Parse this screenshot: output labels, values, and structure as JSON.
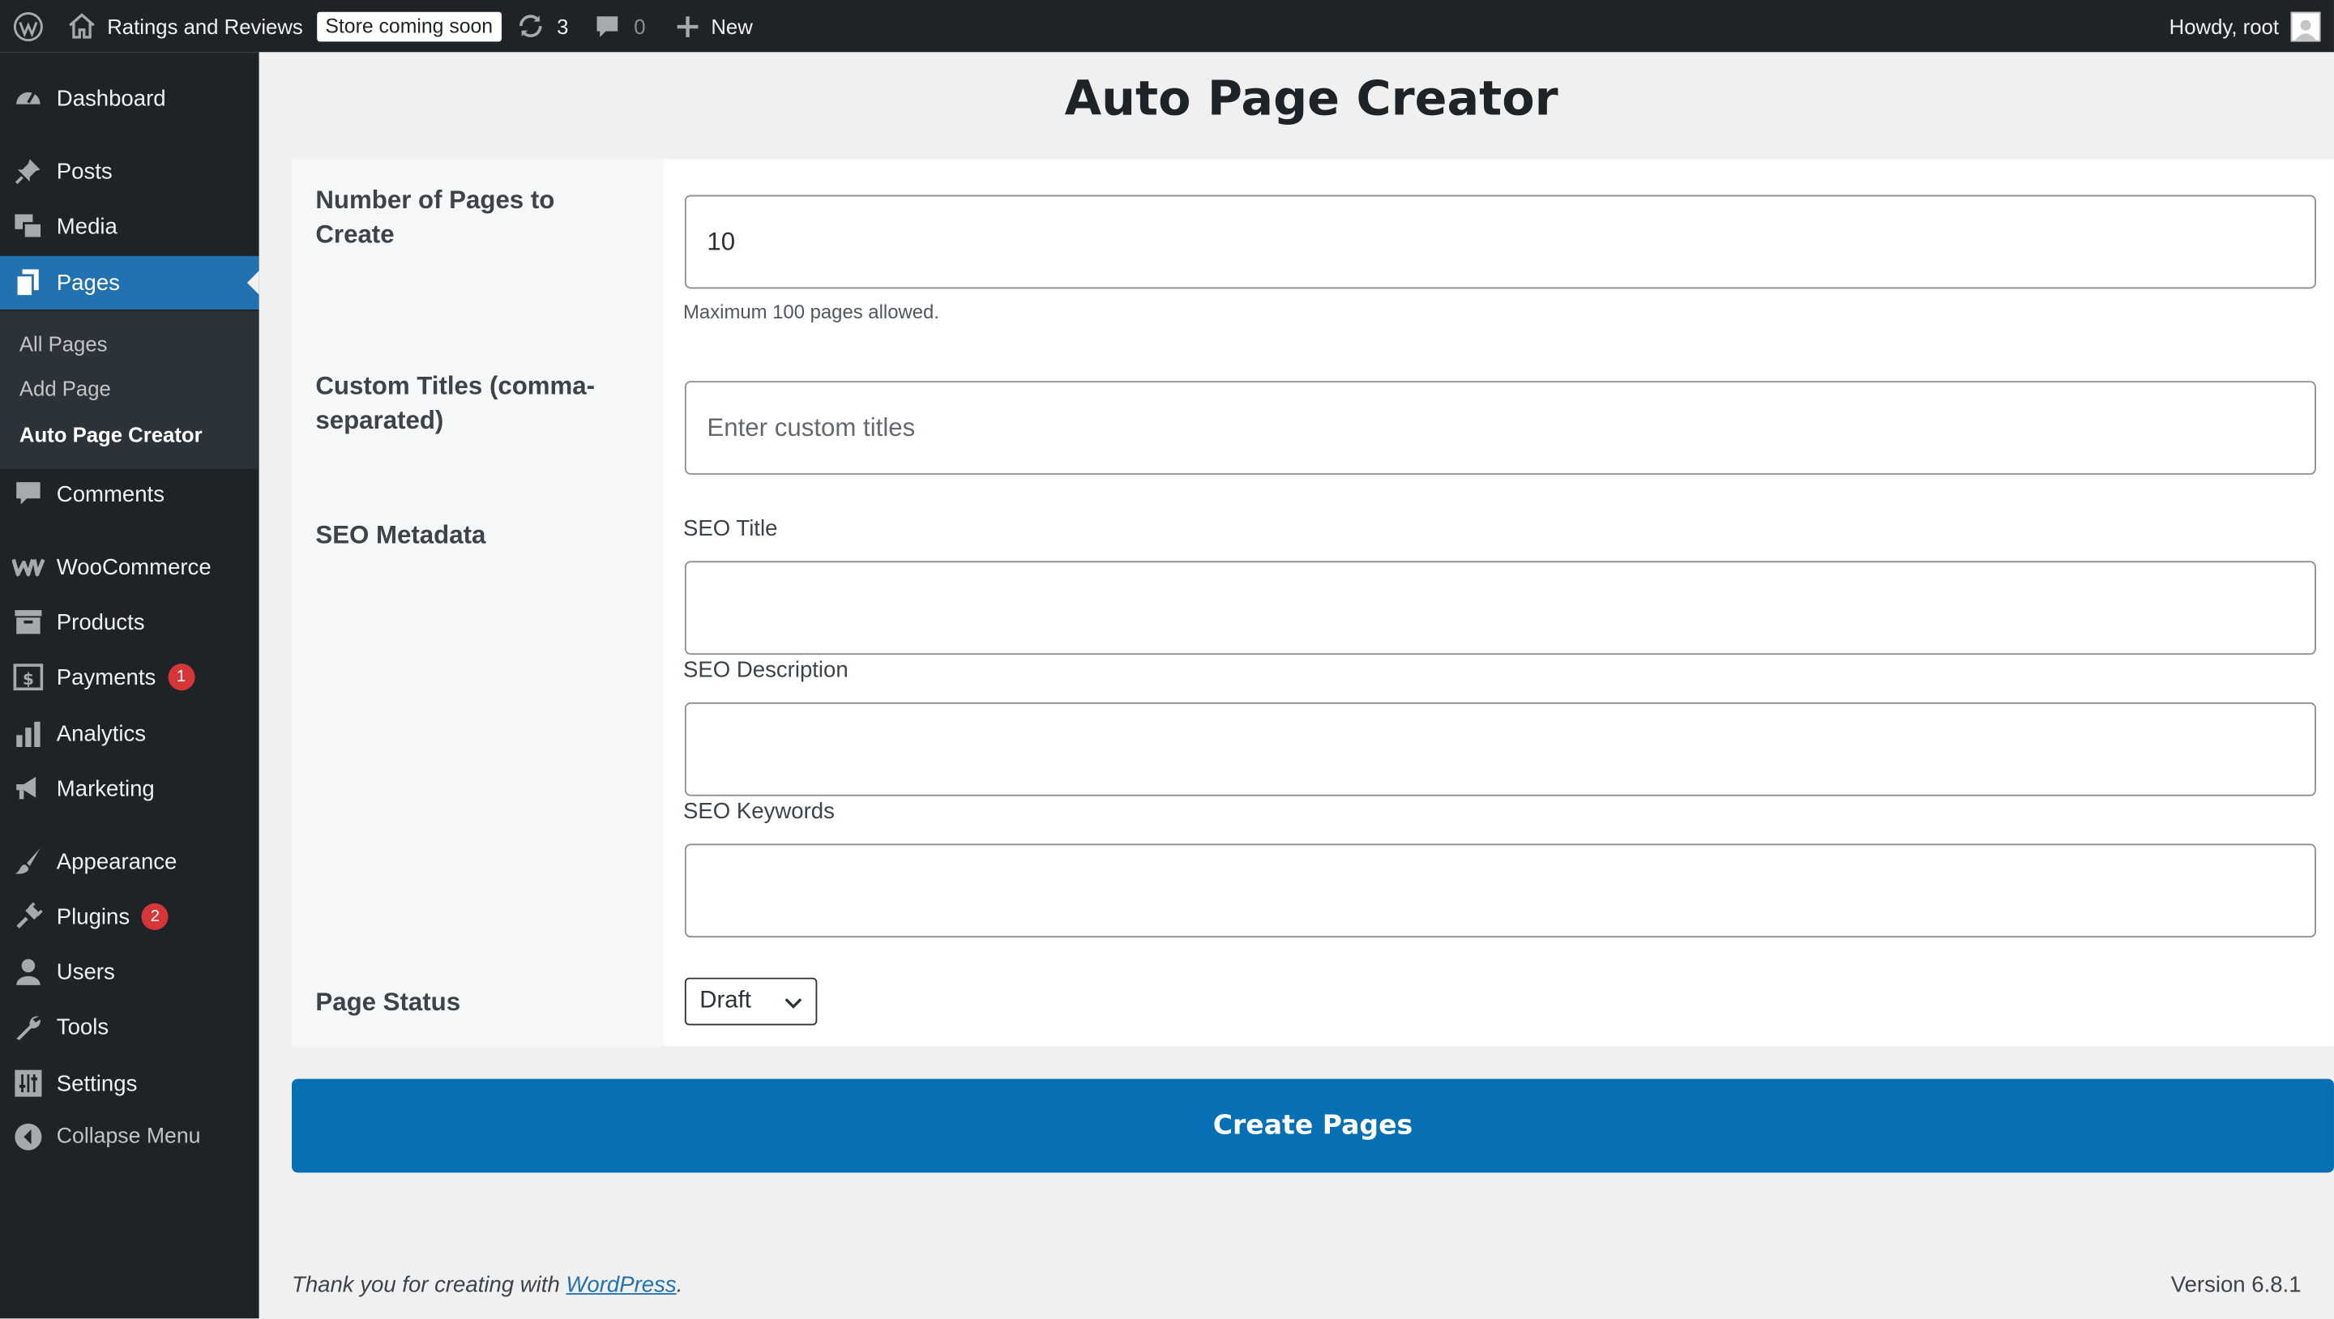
{
  "admin_bar": {
    "site_name": "Ratings and Reviews",
    "store_badge": "Store coming soon",
    "updates_count": "3",
    "comments_count": "0",
    "new_label": "New",
    "greeting": "Howdy, root"
  },
  "sidebar": {
    "dashboard": "Dashboard",
    "posts": "Posts",
    "media": "Media",
    "pages": "Pages",
    "sub_all_pages": "All Pages",
    "sub_add_page": "Add Page",
    "sub_auto_page_creator": "Auto Page Creator",
    "comments": "Comments",
    "woocommerce": "WooCommerce",
    "products": "Products",
    "payments": "Payments",
    "payments_badge": "1",
    "analytics": "Analytics",
    "marketing": "Marketing",
    "appearance": "Appearance",
    "plugins": "Plugins",
    "plugins_badge": "2",
    "users": "Users",
    "tools": "Tools",
    "settings": "Settings",
    "collapse": "Collapse Menu"
  },
  "main": {
    "title": "Auto Page Creator",
    "num_pages_label": "Number of Pages to Create",
    "num_pages_value": "10",
    "num_pages_hint": "Maximum 100 pages allowed.",
    "custom_titles_label": "Custom Titles (comma-separated)",
    "custom_titles_placeholder": "Enter custom titles",
    "seo_label": "SEO Metadata",
    "seo_title_label": "SEO Title",
    "seo_title_value": "",
    "seo_description_label": "SEO Description",
    "seo_description_value": "",
    "seo_keywords_label": "SEO Keywords",
    "seo_keywords_value": "",
    "page_status_label": "Page Status",
    "page_status_value": "Draft",
    "create_button": "Create Pages"
  },
  "footer": {
    "thanks_prefix": "Thank you for creating with ",
    "thanks_link": "WordPress",
    "thanks_suffix": ".",
    "version": "Version 6.8.1"
  },
  "colors": {
    "admin_bg": "#1d2327",
    "accent": "#2271b1",
    "button": "#0770b5",
    "badge": "#d63638"
  }
}
